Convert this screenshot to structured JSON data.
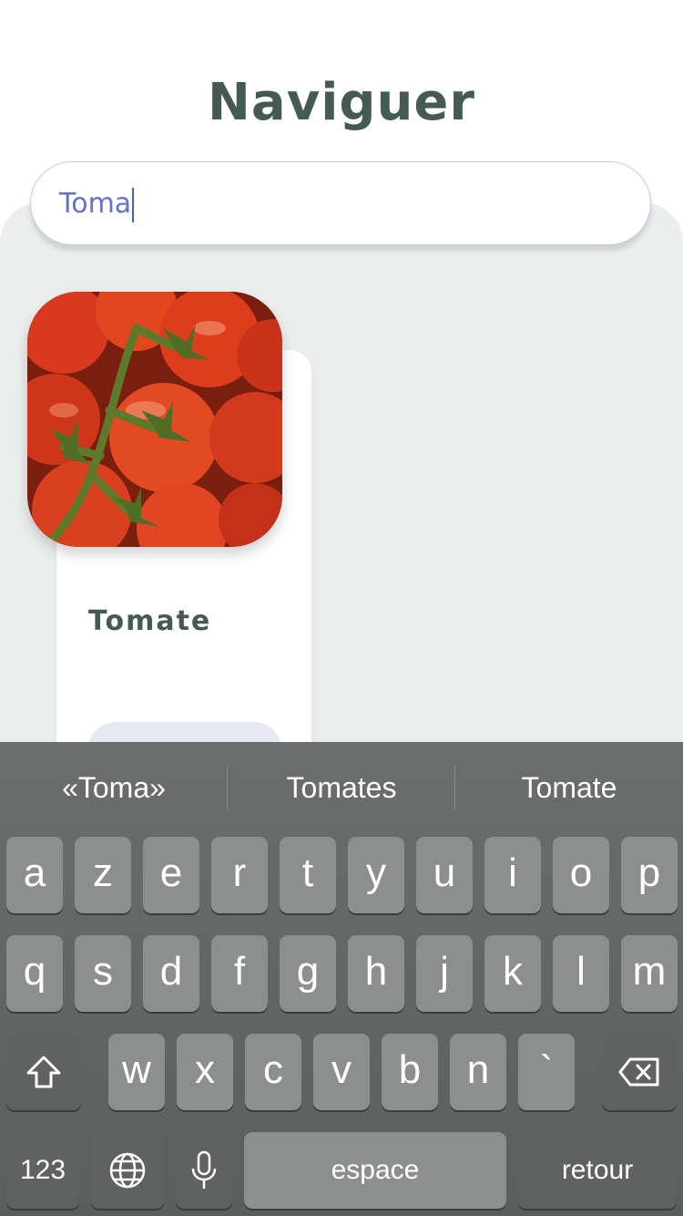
{
  "header": {
    "title": "Naviguer"
  },
  "search": {
    "value": "Toma"
  },
  "results": [
    {
      "name": "Tomate"
    }
  ],
  "keyboard": {
    "suggestions": [
      "«Toma»",
      "Tomates",
      "Tomate"
    ],
    "row1": [
      "a",
      "z",
      "e",
      "r",
      "t",
      "y",
      "u",
      "i",
      "o",
      "p"
    ],
    "row2": [
      "q",
      "s",
      "d",
      "f",
      "g",
      "h",
      "j",
      "k",
      "l",
      "m"
    ],
    "row3": [
      "w",
      "x",
      "c",
      "v",
      "b",
      "n",
      "`"
    ],
    "numbers_label": "123",
    "space_label": "espace",
    "return_label": "retour",
    "icons": {
      "shift": "shift-icon",
      "delete": "backspace-icon",
      "globe": "globe-icon",
      "mic": "microphone-icon"
    }
  }
}
